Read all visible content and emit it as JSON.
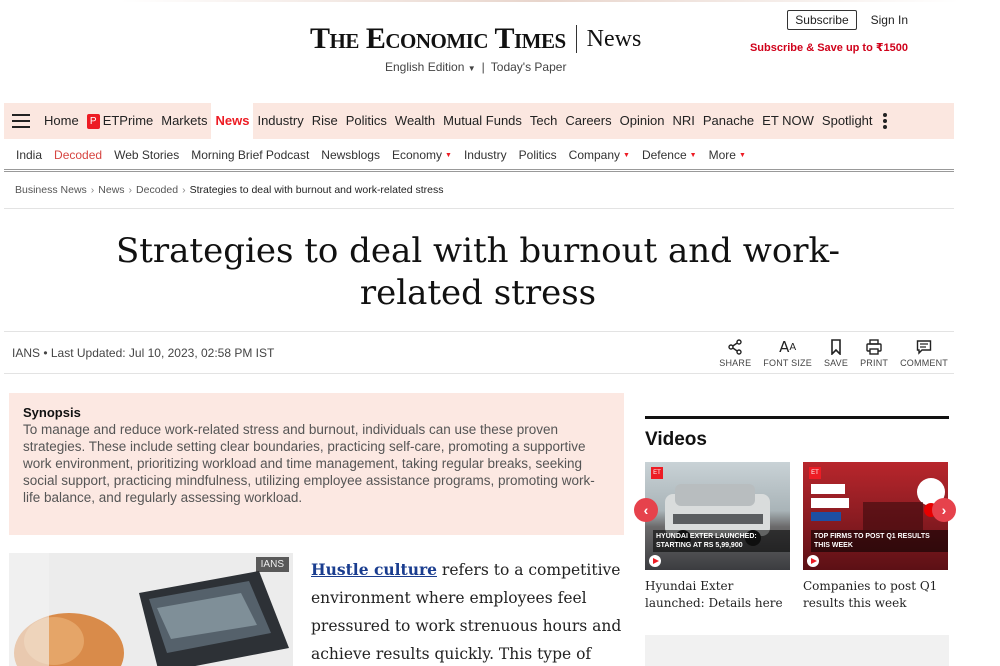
{
  "header": {
    "logo_text": "The Economic Times",
    "section_name": "News",
    "edition_label": "English Edition",
    "edition_separator": "|",
    "todays_paper": "Today's Paper",
    "subscribe_label": "Subscribe",
    "sign_in_label": "Sign In",
    "promo_text": "Subscribe & Save up to ₹1500"
  },
  "nav_primary": {
    "items": [
      {
        "label": "Home"
      },
      {
        "label": "ETPrime",
        "icon": "etprime-icon"
      },
      {
        "label": "Markets"
      },
      {
        "label": "News",
        "active": true
      },
      {
        "label": "Industry"
      },
      {
        "label": "Rise"
      },
      {
        "label": "Politics"
      },
      {
        "label": "Wealth"
      },
      {
        "label": "Mutual Funds"
      },
      {
        "label": "Tech"
      },
      {
        "label": "Careers"
      },
      {
        "label": "Opinion"
      },
      {
        "label": "NRI"
      },
      {
        "label": "Panache"
      },
      {
        "label": "ET NOW"
      },
      {
        "label": "Spotlight"
      }
    ]
  },
  "nav_secondary": {
    "items": [
      {
        "label": "India"
      },
      {
        "label": "Decoded"
      },
      {
        "label": "Web Stories"
      },
      {
        "label": "Morning Brief Podcast"
      },
      {
        "label": "Newsblogs"
      },
      {
        "label": "Economy"
      },
      {
        "label": "Industry"
      },
      {
        "label": "Politics"
      },
      {
        "label": "Company"
      },
      {
        "label": "Defence"
      },
      {
        "label": "More"
      }
    ]
  },
  "breadcrumb": [
    "Business News",
    "News",
    "Decoded",
    "Strategies to deal with burnout and work-related stress"
  ],
  "article": {
    "title": "Strategies to deal with burnout and work-related stress",
    "byline": "IANS • Last Updated: Jul 10, 2023, 02:58 PM IST",
    "tools": [
      {
        "label": "SHARE",
        "icon": "share-icon"
      },
      {
        "label": "FONT SIZE",
        "icon": "font-size-icon"
      },
      {
        "label": "SAVE",
        "icon": "bookmark-icon"
      },
      {
        "label": "PRINT",
        "icon": "print-icon"
      },
      {
        "label": "COMMENT",
        "icon": "comment-icon"
      }
    ],
    "synopsis_heading": "Synopsis",
    "synopsis_text": "To manage and reduce work-related stress and burnout, individuals can use these proven strategies. These include setting clear boundaries, practicing self-care, promoting a supportive work environment, prioritizing workload and time management, taking regular breaks, seeking social support, practicing mindfulness, utilizing employee assistance programs, promoting work-life balance, and regularly assessing workload.",
    "image_credit": "IANS",
    "body_link": "Hustle culture",
    "body_text": " refers to a competitive environment where employees feel pressured to work strenuous hours and achieve results quickly. This type of"
  },
  "videos": {
    "title": "Videos",
    "items": [
      {
        "caption": "Hyundai Exter launched: Details here",
        "thumb_text": "HYUNDAI EXTER LAUNCHED: STARTING AT RS 5,99,900"
      },
      {
        "caption": "Companies to post Q1 results this week",
        "thumb_text": "TOP FIRMS TO POST Q1 RESULTS THIS WEEK"
      }
    ]
  },
  "colors": {
    "accent_red": "#ed1c24",
    "nav_bg": "#fbe7e0",
    "synopsis_bg": "#fce8e2",
    "link_blue": "#1a3d8f"
  }
}
